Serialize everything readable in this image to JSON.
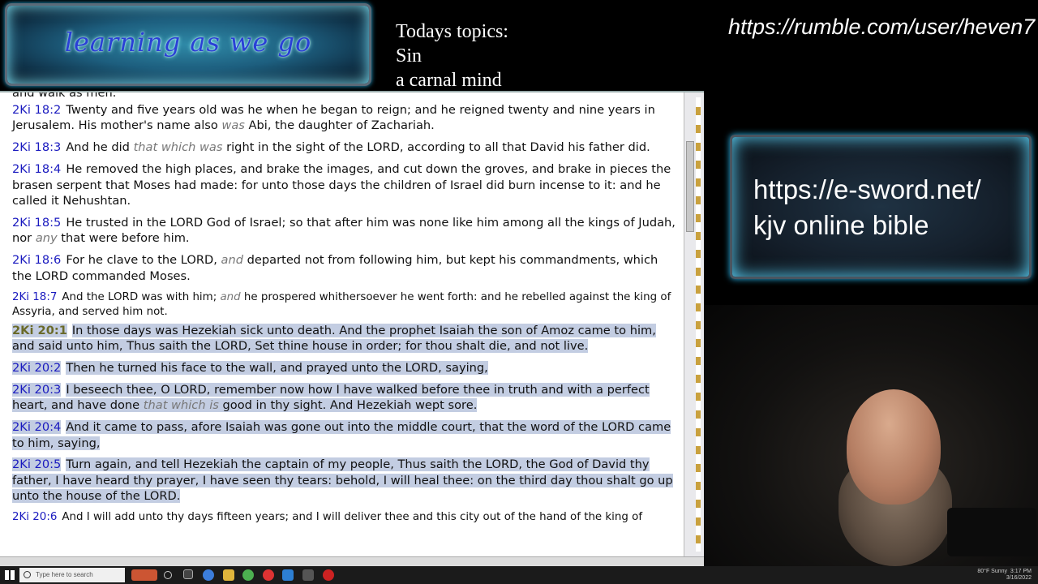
{
  "overlay": {
    "logo_text": "learning as we go",
    "topics_heading": "Todays topics:",
    "topics": [
      "Sin",
      "a carnal mind"
    ],
    "rumble_url": "https://rumble.com/user/heven7",
    "esword_lines": [
      "https://e-sword.net/",
      "kjv online bible"
    ]
  },
  "bible": {
    "top_cut": "and walk as men.",
    "verses": [
      {
        "ref": "2Ki 18:2",
        "parts": [
          {
            "t": "Twenty and five years old was he when he began to reign; and he reigned twenty and nine years in Jerusalem. His mother's name also "
          },
          {
            "t": "was",
            "i": true
          },
          {
            "t": " Abi, the daughter of Zachariah."
          }
        ]
      },
      {
        "ref": "2Ki 18:3",
        "parts": [
          {
            "t": "And he did "
          },
          {
            "t": "that which was",
            "i": true
          },
          {
            "t": " right in the sight of the LORD, according to all that David his father did."
          }
        ]
      },
      {
        "ref": "2Ki 18:4",
        "parts": [
          {
            "t": "He removed the high places, and brake the images, and cut down the groves, and brake in pieces the brasen serpent that Moses had made: for unto those days the children of Israel did burn incense to it: and he called it Nehushtan."
          }
        ]
      },
      {
        "ref": "2Ki 18:5",
        "parts": [
          {
            "t": "He trusted in the LORD God of Israel; so that after him was none like him among all the kings of Judah, nor "
          },
          {
            "t": "any",
            "i": true
          },
          {
            "t": " that were before him."
          }
        ]
      },
      {
        "ref": "2Ki 18:6",
        "parts": [
          {
            "t": "For he clave to the LORD, "
          },
          {
            "t": "and",
            "i": true
          },
          {
            "t": " departed not from following him, but kept his commandments, which the LORD commanded Moses."
          }
        ]
      },
      {
        "ref": "2Ki 18:7",
        "small": true,
        "parts": [
          {
            "t": "And the LORD was with him; "
          },
          {
            "t": "and",
            "i": true
          },
          {
            "t": " he prospered whithersoever he went forth: and he rebelled against the king of Assyria, and served him not."
          }
        ]
      },
      {
        "ref": "2Ki 20:1",
        "bold": true,
        "hl": true,
        "parts": [
          {
            "t": "In those days was Hezekiah sick unto death. And the prophet Isaiah the son of Amoz came to him, and said unto him, Thus saith the LORD, Set thine house in order; for thou shalt die, and not live."
          }
        ]
      },
      {
        "ref": "2Ki 20:2",
        "hl": true,
        "parts": [
          {
            "t": "Then he turned his face to the wall, and prayed unto the LORD, saying,"
          }
        ]
      },
      {
        "ref": "2Ki 20:3",
        "hl": true,
        "parts": [
          {
            "t": "I beseech thee, O LORD, remember now how I have walked before thee in truth and with a perfect heart, and have done "
          },
          {
            "t": "that which is",
            "i": true
          },
          {
            "t": " good in thy sight. And Hezekiah wept sore."
          }
        ]
      },
      {
        "ref": "2Ki 20:4",
        "hl": true,
        "parts": [
          {
            "t": "And it came to pass, afore Isaiah was gone out into the middle court, that the word of the LORD came to him, saying,"
          }
        ]
      },
      {
        "ref": "2Ki 20:5",
        "hl": true,
        "parts": [
          {
            "t": "Turn again, and tell Hezekiah the captain of my people, Thus saith the LORD, the God of David thy father, I have heard thy prayer, I have seen thy tears: behold, I will heal thee: on the third day thou shalt go up unto the house of the LORD."
          }
        ]
      },
      {
        "ref": "2Ki 20:6",
        "small": true,
        "parts": [
          {
            "t": "And I will add unto thy days fifteen years; and I will deliver thee and this city out of the hand of the king of"
          }
        ]
      }
    ]
  },
  "taskbar": {
    "search_placeholder": "Type here to search",
    "weather": "80°F Sunny",
    "time": "3:17 PM",
    "date": "3/16/2022"
  }
}
